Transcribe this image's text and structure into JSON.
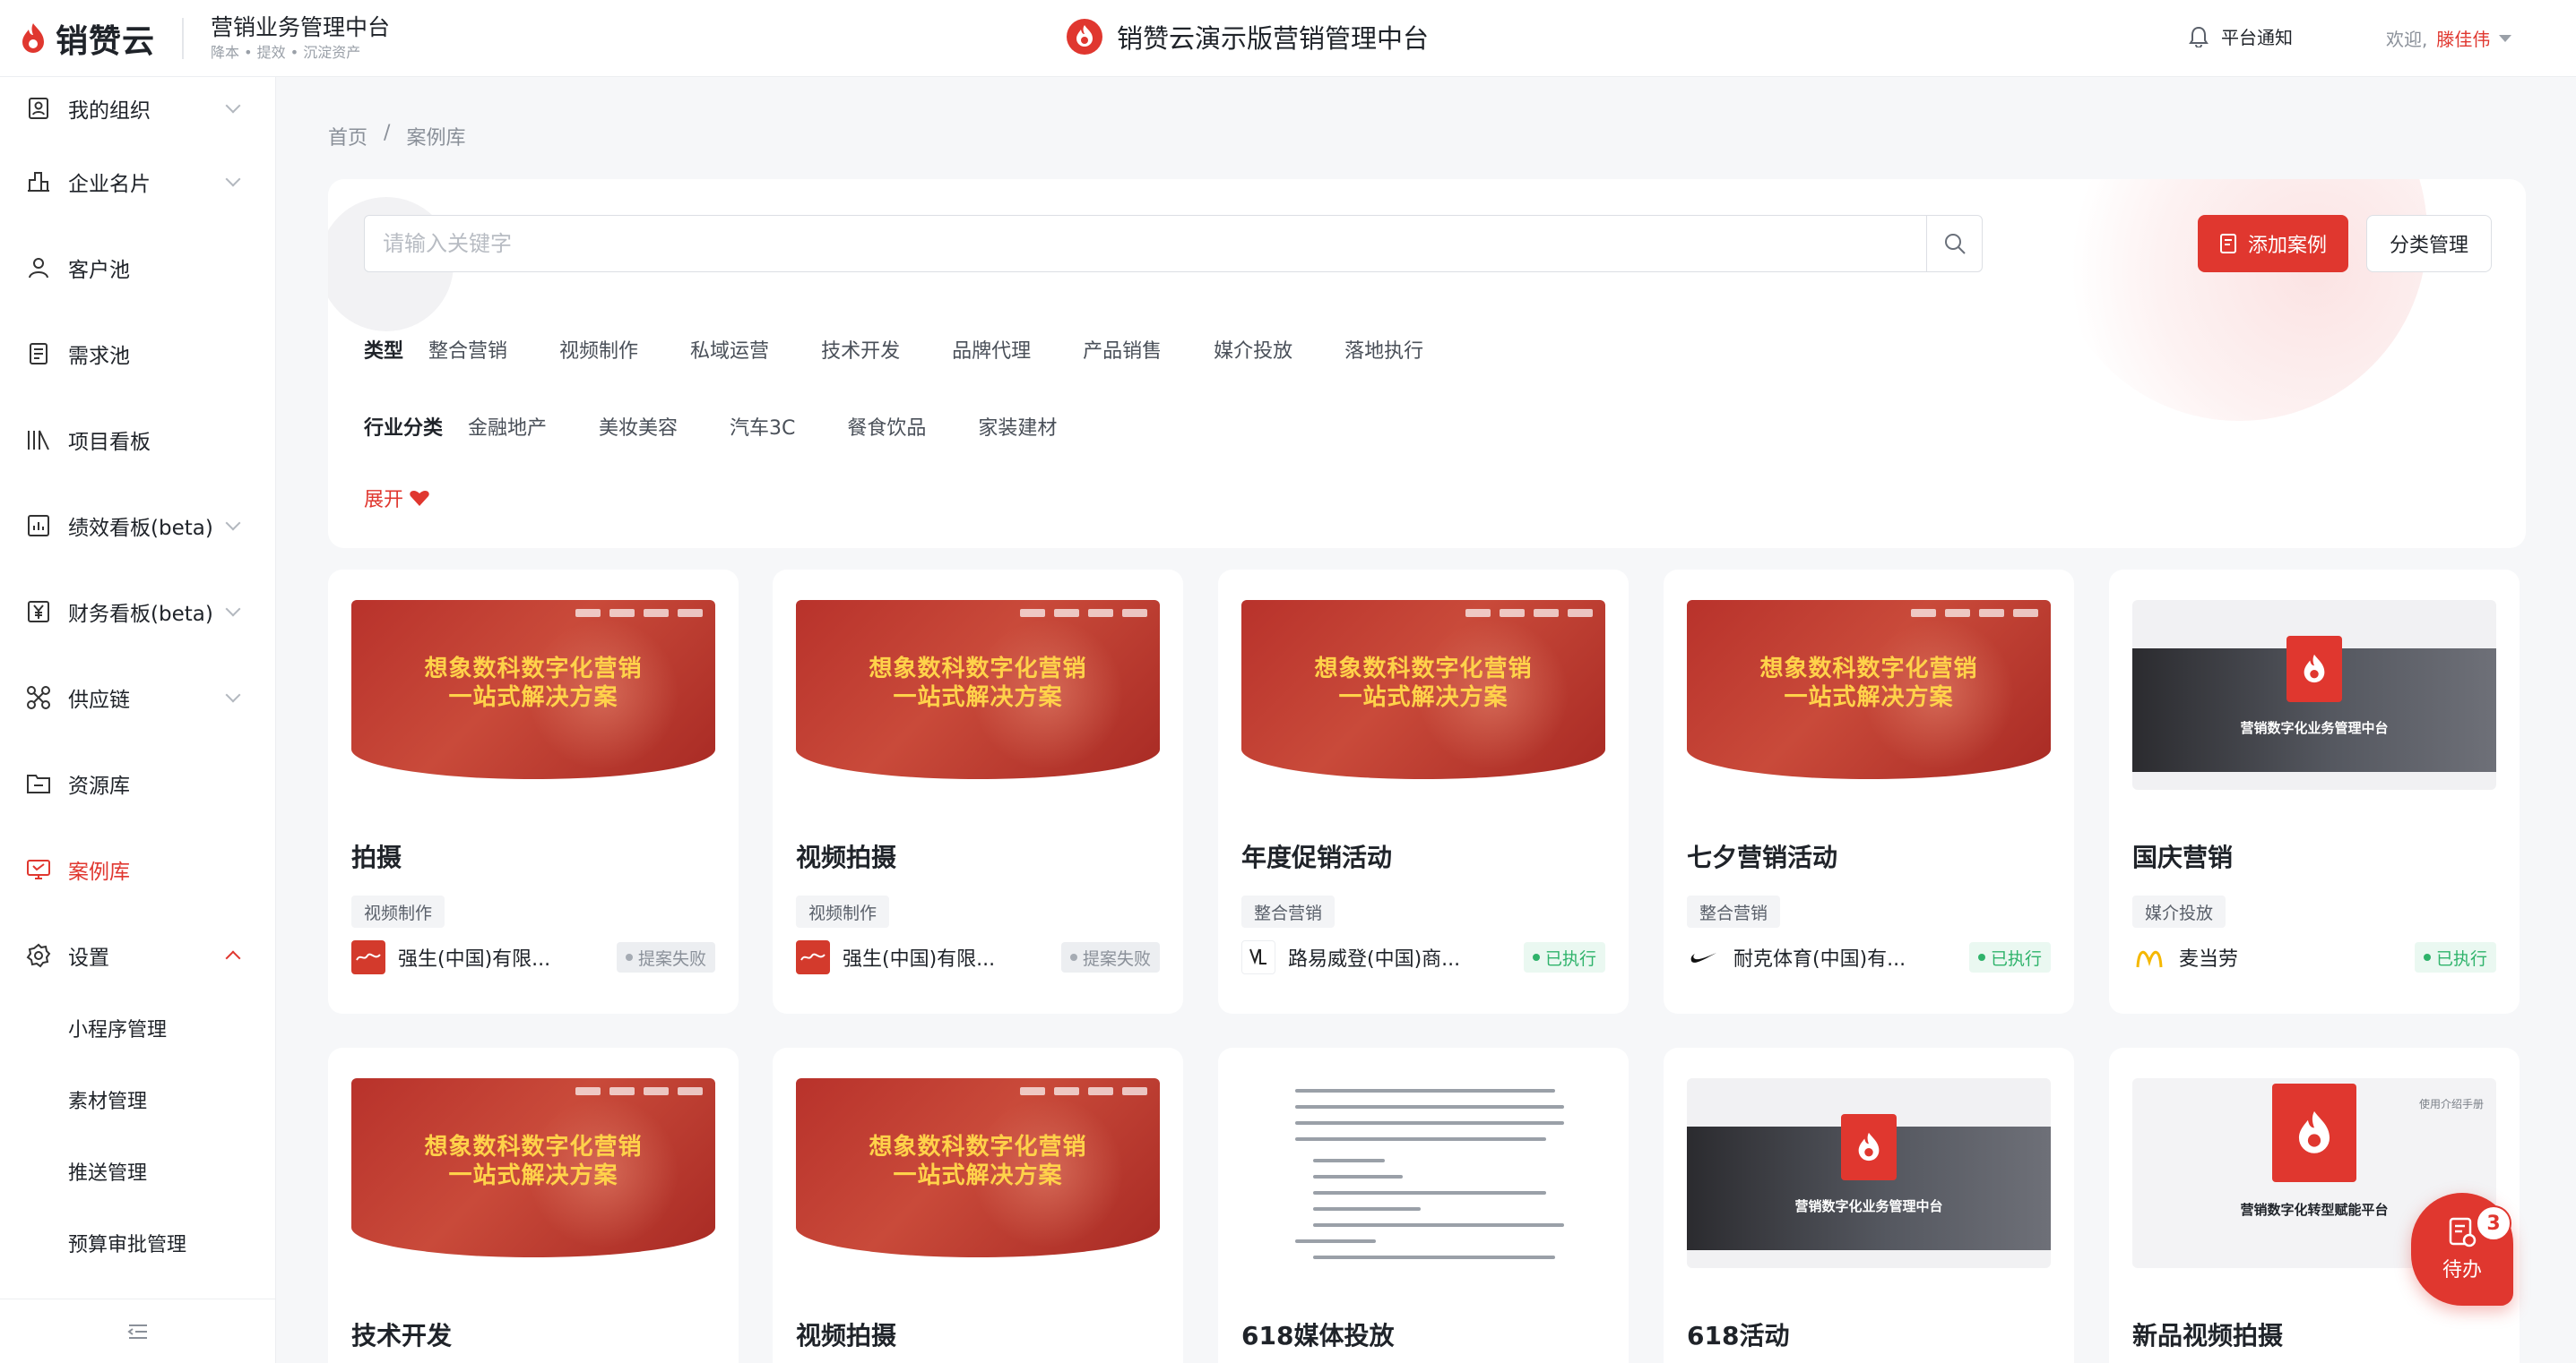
{
  "header": {
    "logo_text": "销赞云",
    "subtitle": "营销业务管理中台",
    "subtitle_tags": "降本 • 提效 • 沉淀资产",
    "center_title": "销赞云演示版营销管理中台",
    "notice_label": "平台通知",
    "welcome_label": "欢迎,",
    "user_name": "滕佳伟"
  },
  "sidebar": {
    "items": [
      {
        "label": "我的组织",
        "icon": "org-icon"
      },
      {
        "label": "企业名片",
        "icon": "building-icon"
      },
      {
        "label": "客户池",
        "icon": "user-icon"
      },
      {
        "label": "需求池",
        "icon": "doc-icon"
      },
      {
        "label": "项目看板",
        "icon": "board-icon"
      },
      {
        "label": "绩效看板(beta)",
        "icon": "chart-icon"
      },
      {
        "label": "财务看板(beta)",
        "icon": "yen-icon"
      },
      {
        "label": "供应链",
        "icon": "chain-icon"
      },
      {
        "label": "资源库",
        "icon": "folder-icon"
      },
      {
        "label": "案例库",
        "icon": "case-icon"
      },
      {
        "label": "设置",
        "icon": "gear-icon"
      }
    ],
    "sub_items": [
      "小程序管理",
      "素材管理",
      "推送管理",
      "预算审批管理"
    ]
  },
  "breadcrumb": {
    "home": "首页",
    "separator": "/",
    "current": "案例库"
  },
  "search": {
    "placeholder": "请输入关键字"
  },
  "buttons": {
    "add": "添加案例",
    "manage": "分类管理"
  },
  "filters": {
    "type_label": "类型",
    "type_options": [
      "整合营销",
      "视频制作",
      "私域运营",
      "技术开发",
      "品牌代理",
      "产品销售",
      "媒介投放",
      "落地执行"
    ],
    "industry_label": "行业分类",
    "industry_options": [
      "金融地产",
      "美妆美容",
      "汽车3C",
      "餐食饮品",
      "家装建材"
    ],
    "expand_label": "展开"
  },
  "thumb_text": {
    "red_line1": "想象数科数字化营销",
    "red_line2": "一站式解决方案",
    "dark_caption": "营销数字化业务管理中台",
    "light_caption": "营销数字化转型赋能平台",
    "light_corner": "使用介绍手册"
  },
  "cards": [
    {
      "title": "拍摄",
      "tag": "视频制作",
      "client": "强生(中国)有限...",
      "status": "提案失败",
      "thumb": "red"
    },
    {
      "title": "视频拍摄",
      "tag": "视频制作",
      "client": "强生(中国)有限...",
      "status": "提案失败",
      "thumb": "red"
    },
    {
      "title": "年度促销活动",
      "tag": "整合营销",
      "client": "路易威登(中国)商...",
      "status": "已执行",
      "thumb": "red"
    },
    {
      "title": "七夕营销活动",
      "tag": "整合营销",
      "client": "耐克体育(中国)有...",
      "status": "已执行",
      "thumb": "red"
    },
    {
      "title": "国庆营销",
      "tag": "媒介投放",
      "client": "麦当劳",
      "status": "已执行",
      "thumb": "dark"
    },
    {
      "title": "技术开发",
      "thumb": "red"
    },
    {
      "title": "视频拍摄",
      "thumb": "red"
    },
    {
      "title": "618媒体投放",
      "thumb": "doc"
    },
    {
      "title": "618活动",
      "thumb": "dark"
    },
    {
      "title": "新品视频拍摄",
      "thumb": "light"
    }
  ],
  "todo": {
    "label": "待办",
    "count": "3"
  },
  "colors": {
    "brand": "#e0372f",
    "success": "#2fb36b",
    "muted": "#8a9099"
  }
}
